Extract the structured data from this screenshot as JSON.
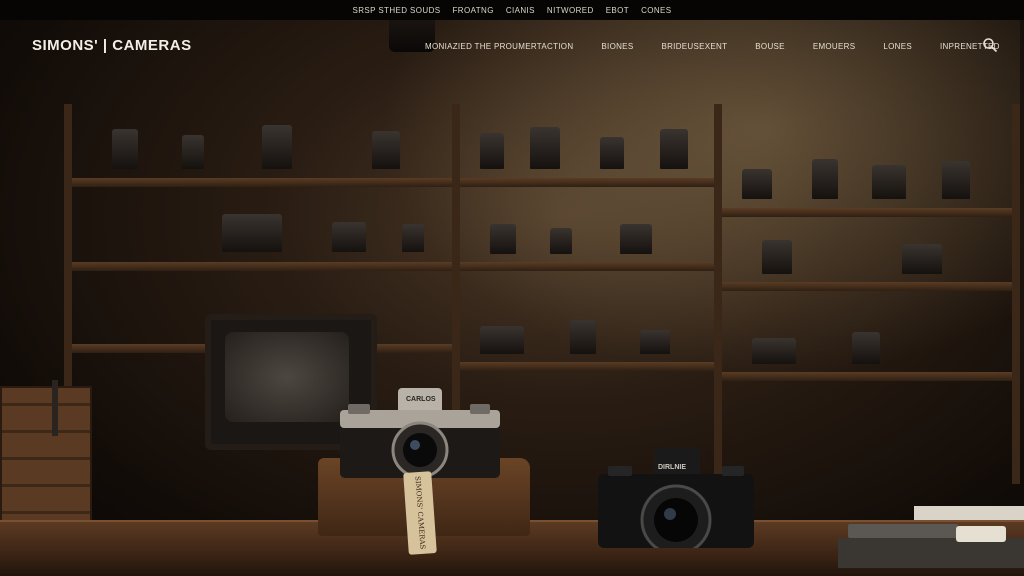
{
  "topbar": {
    "links": [
      "SRSP STHED SOUDS",
      "FROATNG",
      "CIANIS",
      "NITWORED",
      "EBOT",
      "CONES"
    ]
  },
  "nav": {
    "logo": "SIMONS' | CAMERAS",
    "items": [
      "MONIAZIED THE PROUMERTACTION",
      "BIONES",
      "BRIDEUSEXENT",
      "BOUSE",
      "EMOUERS",
      "LONES",
      "INPRENETTED"
    ]
  },
  "icons": {
    "search": "search-icon"
  },
  "scene": {
    "silver_camera_label": "CARLOS",
    "black_camera_label": "DIRLNIE",
    "tag_text": "SIMONS' CAMERAS"
  },
  "colors": {
    "topbar_bg": "#060504",
    "nav_text": "#e6dfd2",
    "wood": "#5c3a22"
  }
}
